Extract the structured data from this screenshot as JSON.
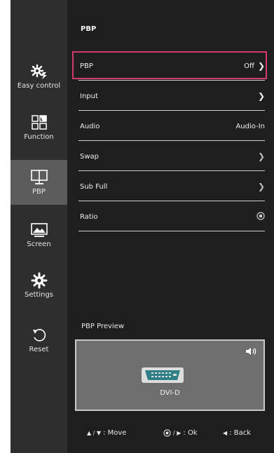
{
  "sidebar": {
    "items": [
      {
        "label": "Easy control",
        "icon": "easy-control-icon",
        "active": false
      },
      {
        "label": "Function",
        "icon": "function-icon",
        "active": false
      },
      {
        "label": "PBP",
        "icon": "pbp-icon",
        "active": true
      },
      {
        "label": "Screen",
        "icon": "screen-icon",
        "active": false
      },
      {
        "label": "Settings",
        "icon": "settings-gear-icon",
        "active": false
      },
      {
        "label": "Reset",
        "icon": "reset-icon",
        "active": false
      }
    ]
  },
  "header": {
    "title": "PBP"
  },
  "menu": {
    "rows": [
      {
        "label": "PBP",
        "value": "Off",
        "control": "chevron-right-icon",
        "selected": true
      },
      {
        "label": "Input",
        "value": "",
        "control": "chevron-right-icon"
      },
      {
        "label": "Audio",
        "value": "Audio-In",
        "control": ""
      },
      {
        "label": "Swap",
        "value": "",
        "control": "chevron-right-icon"
      },
      {
        "label": "Sub Full",
        "value": "",
        "control": "chevron-right-icon"
      },
      {
        "label": "Ratio",
        "value": "",
        "control": "radio-icon"
      }
    ]
  },
  "preview": {
    "label": "PBP Preview",
    "input_label": "DVI-D",
    "icons": [
      "speaker-icon",
      "dvi-connector-icon"
    ]
  },
  "footer": {
    "move_label": ": Move",
    "ok_label": ": Ok",
    "back_label": ": Back"
  },
  "colors": {
    "highlight": "#d43a6d",
    "sidebar_bg": "#2e2e2e",
    "sidebar_active_bg": "#5c5c5c",
    "main_bg": "#1e1e1e",
    "preview_bg": "#6e6e6e"
  }
}
